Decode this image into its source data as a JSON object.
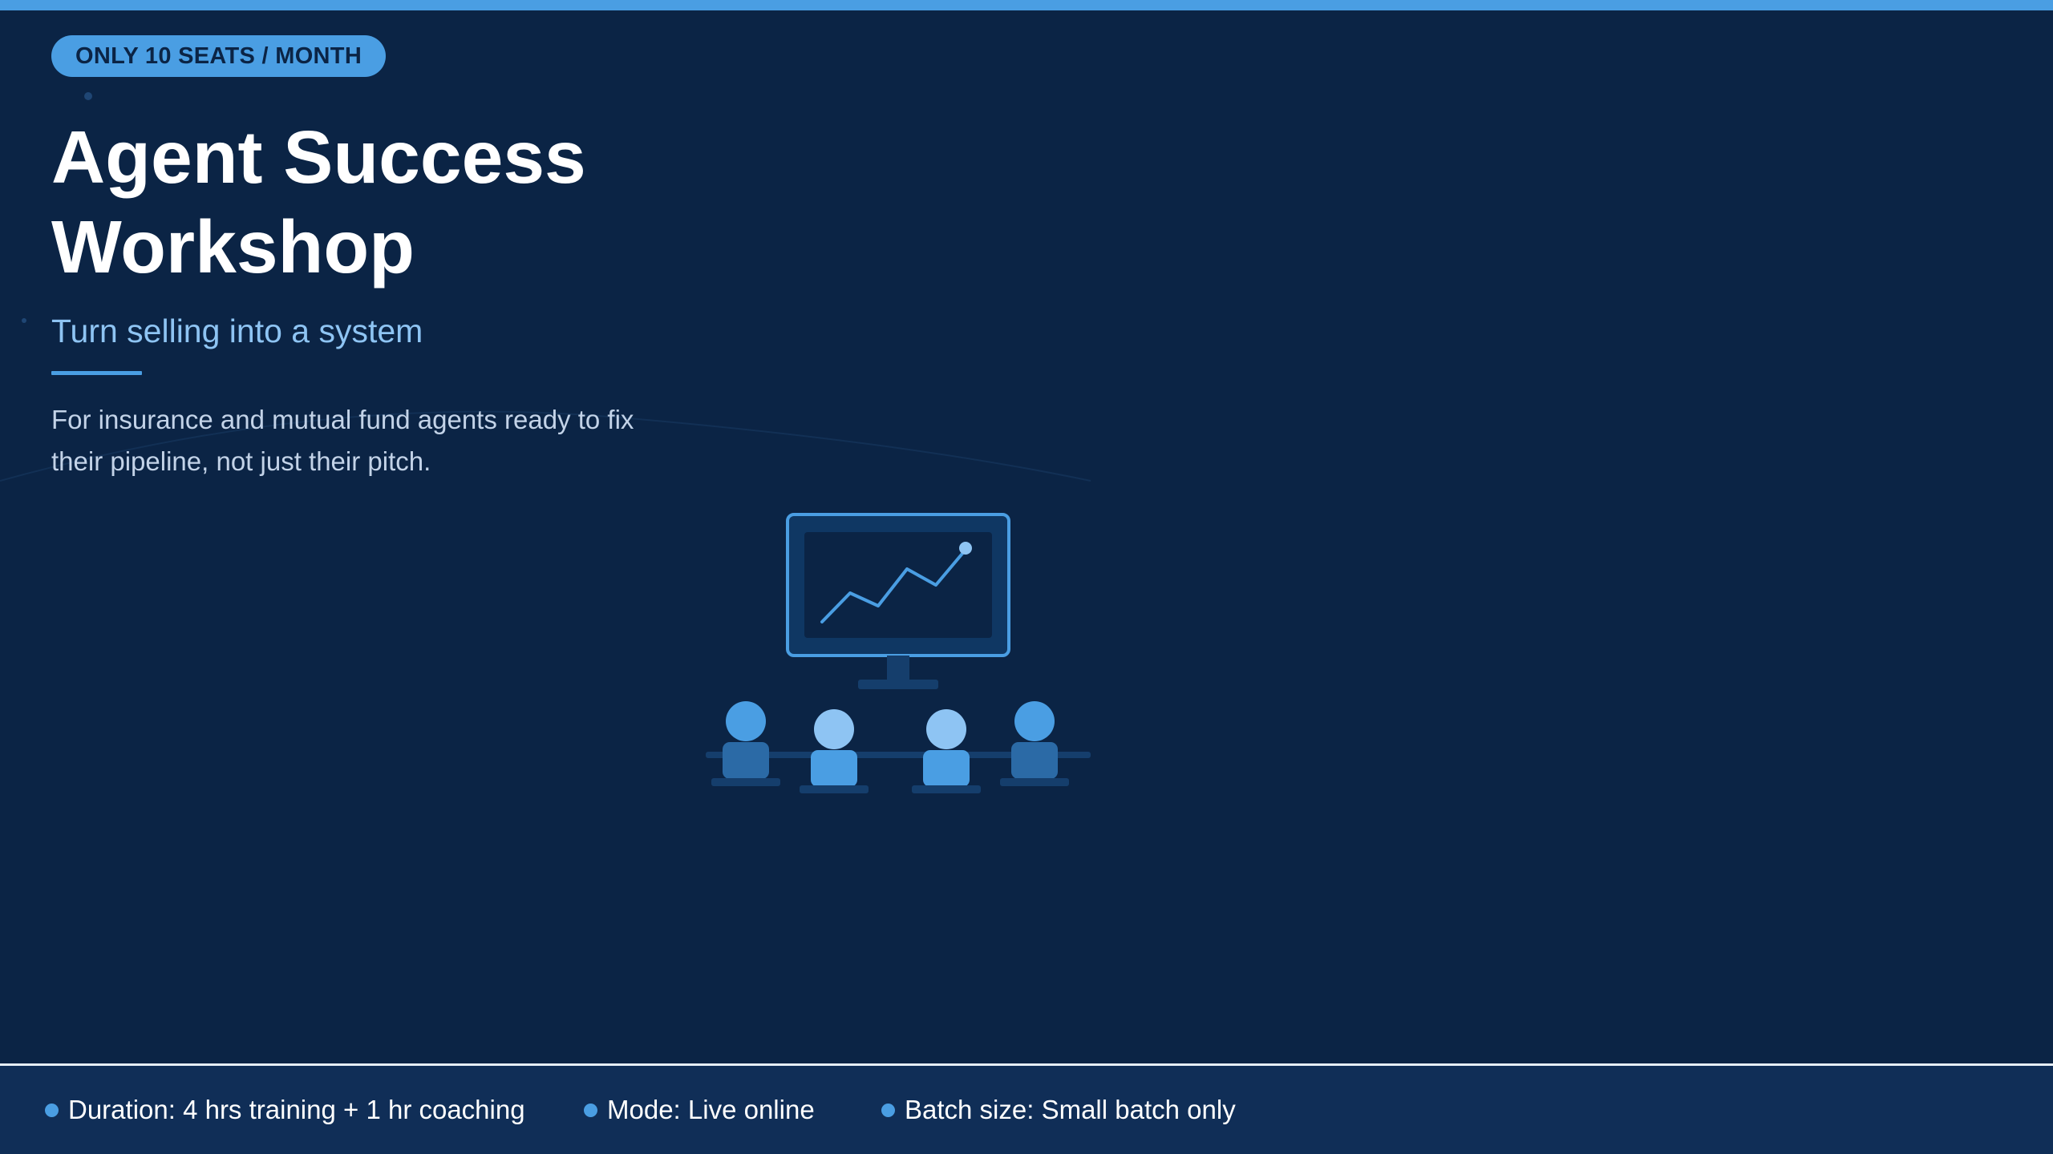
{
  "badge": "ONLY 10 SEATS / MONTH",
  "title": "Agent Success Workshop",
  "subtitle": "Turn selling into a system",
  "description": "For insurance and mutual fund agents ready to fix their pipeline, not just their pitch.",
  "illustration": {
    "icons": [
      "monitor-icon",
      "growth-chart-icon",
      "attendee-icon"
    ],
    "attendee_count": 4
  },
  "footer": {
    "items": [
      {
        "label": "Duration: 4 hrs training + 1 hr coaching"
      },
      {
        "label": "Mode: Live online"
      },
      {
        "label": "Batch size: Small batch only"
      }
    ]
  },
  "colors": {
    "background": "#0b2445",
    "accent": "#4a9ee3",
    "accent_light": "#8ec4f3",
    "footer_background": "#102e57",
    "body_text": "#c3d3e8"
  }
}
